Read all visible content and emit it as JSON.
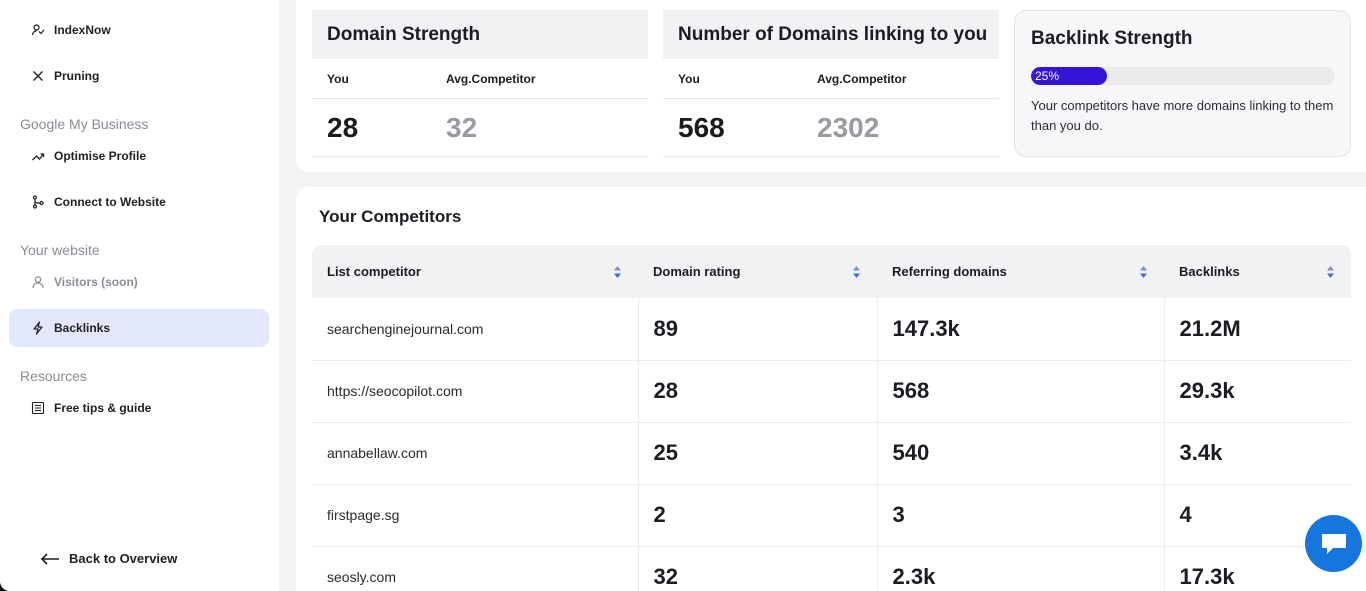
{
  "sidebar": {
    "items_top": [
      {
        "label": "IndexNow",
        "icon": "indexnow-icon"
      },
      {
        "label": "Pruning",
        "icon": "close-icon"
      }
    ],
    "sections": [
      {
        "label": "Google My Business",
        "items": [
          {
            "label": "Optimise Profile",
            "icon": "trend-up-icon"
          },
          {
            "label": "Connect to Website",
            "icon": "branch-icon"
          }
        ]
      },
      {
        "label": "Your website",
        "items": [
          {
            "label": "Visitors (soon)",
            "icon": "user-icon"
          },
          {
            "label": "Backlinks",
            "icon": "bolt-icon",
            "active": true
          }
        ]
      },
      {
        "label": "Resources",
        "items": [
          {
            "label": "Free tips & guide",
            "icon": "document-icon"
          }
        ]
      }
    ],
    "back_label": "Back to Overview"
  },
  "metrics": {
    "domain_strength": {
      "title": "Domain Strength",
      "you_label": "You",
      "competitor_label": "Avg.Competitor",
      "you_value": "28",
      "competitor_value": "32"
    },
    "linking_domains": {
      "title": "Number of Domains linking to you",
      "you_label": "You",
      "competitor_label": "Avg.Competitor",
      "you_value": "568",
      "competitor_value": "2302"
    }
  },
  "backlink_strength": {
    "title": "Backlink Strength",
    "percent_label": "25%",
    "fill_fraction": 0.25,
    "message": "Your competitors have more domains linking to them than you do."
  },
  "competitors": {
    "title": "Your Competitors",
    "columns": [
      "List competitor",
      "Domain rating",
      "Referring domains",
      "Backlinks"
    ],
    "rows": [
      [
        "searchenginejournal.com",
        "89",
        "147.3k",
        "21.2M"
      ],
      [
        "https://seocopilot.com",
        "28",
        "568",
        "29.3k"
      ],
      [
        "annabellaw.com",
        "25",
        "540",
        "3.4k"
      ],
      [
        "firstpage.sg",
        "2",
        "3",
        "4"
      ],
      [
        "seosly.com",
        "32",
        "2.3k",
        "17.3k"
      ]
    ]
  },
  "colors": {
    "accent": "#3414d9",
    "active_nav": "#e3e7fb",
    "chat_button": "#1577dd"
  }
}
